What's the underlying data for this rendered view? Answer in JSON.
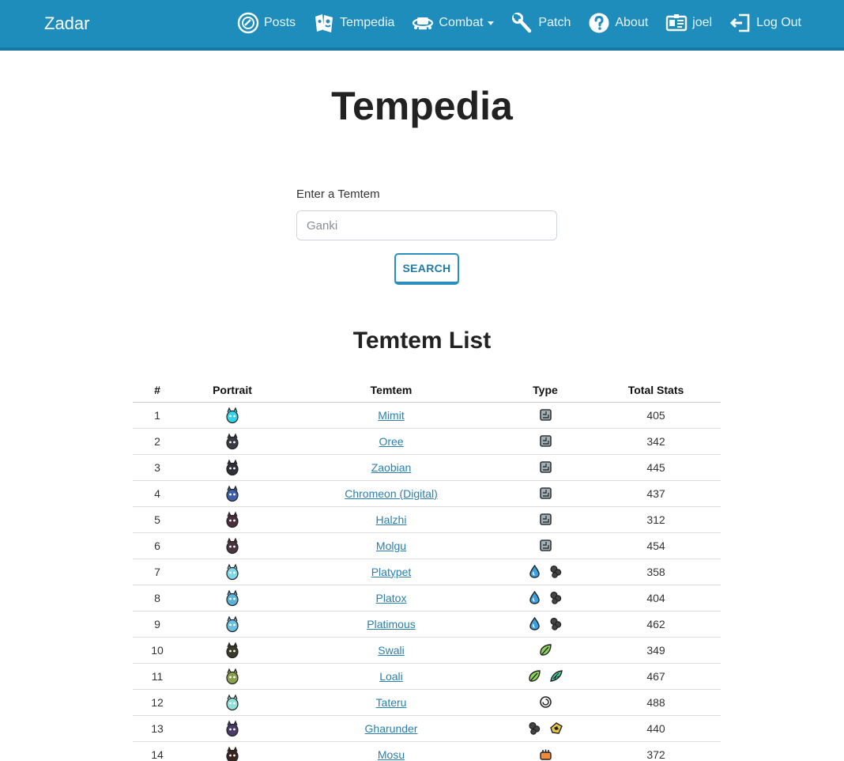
{
  "navbar": {
    "brand": "Zadar",
    "items": [
      {
        "label": "Posts",
        "icon": "posts-icon"
      },
      {
        "label": "Tempedia",
        "icon": "tempedia-icon"
      },
      {
        "label": "Combat",
        "icon": "combat-icon",
        "dropdown": true
      },
      {
        "label": "Patch",
        "icon": "wrench-icon"
      },
      {
        "label": "About",
        "icon": "question-icon"
      },
      {
        "label": "joel",
        "icon": "id-card-icon"
      },
      {
        "label": "Log Out",
        "icon": "logout-icon"
      }
    ],
    "colors": {
      "background": "#1f8dbb",
      "text": "#e9f4fa"
    }
  },
  "page": {
    "title": "Tempedia"
  },
  "search": {
    "label": "Enter a Temtem",
    "placeholder": "Ganki",
    "button_label": "SEARCH"
  },
  "list": {
    "title": "Temtem List",
    "headers": {
      "num": "#",
      "portrait": "Portrait",
      "name": "Temtem",
      "type": "Type",
      "total": "Total Stats"
    },
    "rows": [
      {
        "num": "1",
        "name": "Mimit",
        "types": [
          "digital"
        ],
        "total": "405",
        "portrait_color": "#33d4e8"
      },
      {
        "num": "2",
        "name": "Oree",
        "types": [
          "digital"
        ],
        "total": "342",
        "portrait_color": "#3a3a44"
      },
      {
        "num": "3",
        "name": "Zaobian",
        "types": [
          "digital"
        ],
        "total": "445",
        "portrait_color": "#2f2f38"
      },
      {
        "num": "4",
        "name": "Chromeon (Digital)",
        "types": [
          "digital"
        ],
        "total": "437",
        "portrait_color": "#3e5fa8"
      },
      {
        "num": "5",
        "name": "Halzhi",
        "types": [
          "digital"
        ],
        "total": "312",
        "portrait_color": "#4a2e3e"
      },
      {
        "num": "6",
        "name": "Molgu",
        "types": [
          "digital"
        ],
        "total": "454",
        "portrait_color": "#4b3540"
      },
      {
        "num": "7",
        "name": "Platypet",
        "types": [
          "water",
          "toxic"
        ],
        "total": "358",
        "portrait_color": "#7fd8e6"
      },
      {
        "num": "8",
        "name": "Platox",
        "types": [
          "water",
          "toxic"
        ],
        "total": "404",
        "portrait_color": "#5ab2d6"
      },
      {
        "num": "9",
        "name": "Platimous",
        "types": [
          "water",
          "toxic"
        ],
        "total": "462",
        "portrait_color": "#6ac0e0"
      },
      {
        "num": "10",
        "name": "Swali",
        "types": [
          "nature"
        ],
        "total": "349",
        "portrait_color": "#3c3a2a"
      },
      {
        "num": "11",
        "name": "Loali",
        "types": [
          "nature",
          "wind"
        ],
        "total": "467",
        "portrait_color": "#8aa04a"
      },
      {
        "num": "12",
        "name": "Tateru",
        "types": [
          "neutral"
        ],
        "total": "488",
        "portrait_color": "#8fe0d8"
      },
      {
        "num": "13",
        "name": "Gharunder",
        "types": [
          "toxic",
          "earth"
        ],
        "total": "440",
        "portrait_color": "#4a3a6a"
      },
      {
        "num": "14",
        "name": "Mosu",
        "types": [
          "melee"
        ],
        "total": "372",
        "portrait_color": "#3a2420"
      }
    ]
  }
}
